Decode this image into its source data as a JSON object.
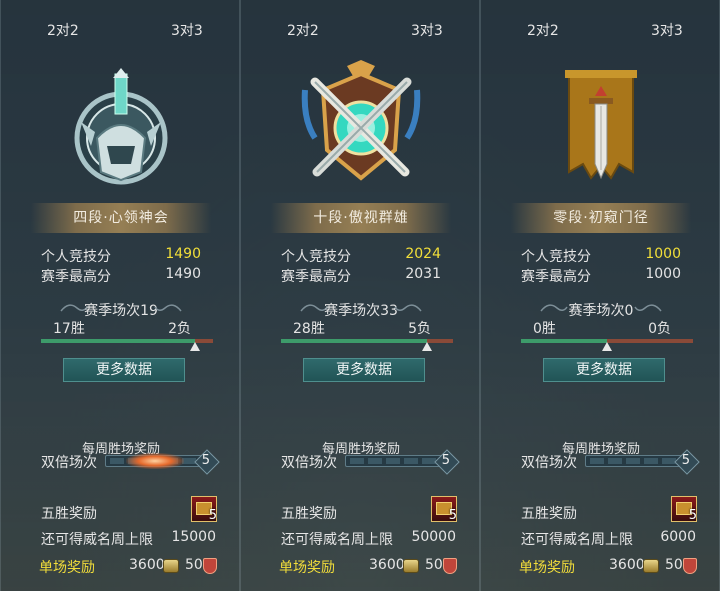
{
  "panels": [
    {
      "mode_tab_a": "2对2",
      "mode_tab_b": "3对3",
      "emblem_icon": "silver-helmet-emblem-icon",
      "rank_name": "四段·心领神会",
      "stat1_label": "个人竞技分",
      "stat1_value": "1490",
      "stat2_label": "赛季最高分",
      "stat2_value": "1490",
      "season_title": "赛季场次19",
      "wins": "17胜",
      "losses": "2负",
      "win_ratio": 0.895,
      "more_button": "更多数据",
      "weekly_title": "每周胜场奖励",
      "double_label": "双倍场次",
      "double_count": "5",
      "double_progress": 0.45,
      "five_win_label": "五胜奖励",
      "chest_count": "5",
      "remaining_label": "还可得威名周上限",
      "remaining_value": "15000",
      "single_label": "单场奖励",
      "coin_value": "3600",
      "shield_value": "50"
    },
    {
      "mode_tab_a": "2对2",
      "mode_tab_b": "3对3",
      "emblem_icon": "crossed-swords-shield-emblem-icon",
      "rank_name": "十段·傲视群雄",
      "stat1_label": "个人竞技分",
      "stat1_value": "2024",
      "stat2_label": "赛季最高分",
      "stat2_value": "2031",
      "season_title": "赛季场次33",
      "wins": "28胜",
      "losses": "5负",
      "win_ratio": 0.848,
      "more_button": "更多数据",
      "weekly_title": "每周胜场奖励",
      "double_label": "双倍场次",
      "double_count": "5",
      "double_progress": 0,
      "five_win_label": "五胜奖励",
      "chest_count": "5",
      "remaining_label": "还可得威名周上限",
      "remaining_value": "50000",
      "single_label": "单场奖励",
      "coin_value": "3600",
      "shield_value": "50"
    },
    {
      "mode_tab_a": "2对2",
      "mode_tab_b": "3对3",
      "emblem_icon": "sword-banner-emblem-icon",
      "rank_name": "零段·初窥门径",
      "stat1_label": "个人竞技分",
      "stat1_value": "1000",
      "stat2_label": "赛季最高分",
      "stat2_value": "1000",
      "season_title": "赛季场次0",
      "wins": "0胜",
      "losses": "0负",
      "win_ratio": 0.5,
      "more_button": "更多数据",
      "weekly_title": "每周胜场奖励",
      "double_label": "双倍场次",
      "double_count": "5",
      "double_progress": 0,
      "five_win_label": "五胜奖励",
      "chest_count": "5",
      "remaining_label": "还可得威名周上限",
      "remaining_value": "6000",
      "single_label": "单场奖励",
      "coin_value": "3600",
      "shield_value": "50"
    }
  ],
  "colors": {
    "gold_score": "#f2df3a",
    "win_bar": "#3d9b6a",
    "loss_bar": "#8a4a38",
    "button_bg": "#2f6a6c"
  }
}
